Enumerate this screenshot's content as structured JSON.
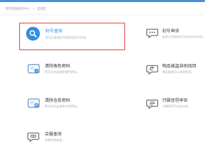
{
  "breadcrumb": {
    "root": "游戏客服服务中心",
    "separator": ">",
    "current": "自助区"
  },
  "cards": [
    {
      "title": "封号查询",
      "desc": "您可以查询封号原因及封号状态。",
      "icon": "search-icon",
      "highlighted": true
    },
    {
      "title": "封号申诉",
      "desc": "若您认为您的封号有误可以申诉。",
      "icon": "chat-bubble-icon",
      "highlighted": false
    },
    {
      "title": "清除角色密码",
      "desc": "您可以在此清除角色密码。",
      "icon": "picture-card-icon",
      "highlighted": false
    },
    {
      "title": "物品被盗自助找回",
      "desc": "物品被盗可以自助找回。",
      "icon": "return-arrow-icon",
      "highlighted": false
    },
    {
      "title": "清除仓库密码",
      "desc": "您可以在此清除仓库密码。",
      "icon": "warehouse-card-icon",
      "highlighted": false
    },
    {
      "title": "行脚惩罚申诉",
      "desc": "行脚惩罚可在此申诉。",
      "icon": "document-icon",
      "highlighted": false
    },
    {
      "title": "合服查询",
      "desc": "合服信息查询。",
      "icon": "merge-icon",
      "highlighted": false
    }
  ],
  "colors": {
    "accent": "#2f8fe0",
    "highlight_border": "#e23a3a",
    "topbar": "#4a8fd4"
  }
}
